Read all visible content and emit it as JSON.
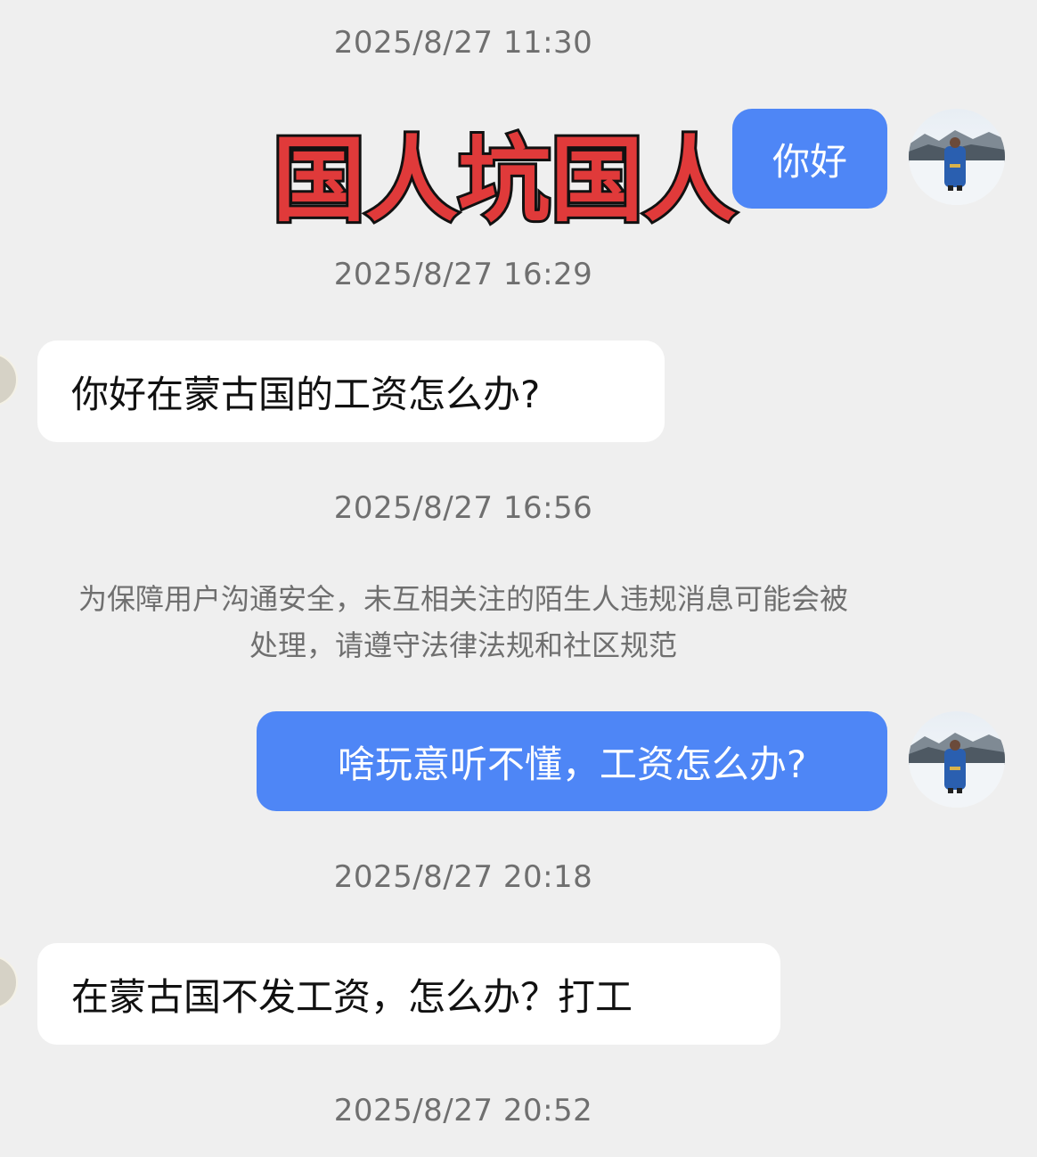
{
  "overlay": {
    "title": "国人坑国人",
    "fill_color": "#e03a3a",
    "stroke_color": "#111111"
  },
  "colors": {
    "outgoing_bubble": "#4e86f6",
    "incoming_bubble": "#ffffff",
    "background": "#efefef",
    "timestamp_text": "#6f6f6f"
  },
  "timestamps": [
    "2025/8/27 11:30",
    "2025/8/27 16:29",
    "2025/8/27 16:56",
    "2025/8/27 20:18",
    "2025/8/27 20:52"
  ],
  "system_notice": {
    "line1": "为保障用户沟通安全，未互相关注的陌生人违规消息可能会被",
    "line2": "处理，请遵守法律法规和社区规范"
  },
  "messages": [
    {
      "direction": "outgoing",
      "text": "你好"
    },
    {
      "direction": "incoming",
      "text": "你好在蒙古国的工资怎么办?"
    },
    {
      "direction": "outgoing",
      "text": "啥玩意听不懂，工资怎么办?"
    },
    {
      "direction": "incoming",
      "text": "在蒙古国不发工资，怎么办？打工"
    }
  ]
}
